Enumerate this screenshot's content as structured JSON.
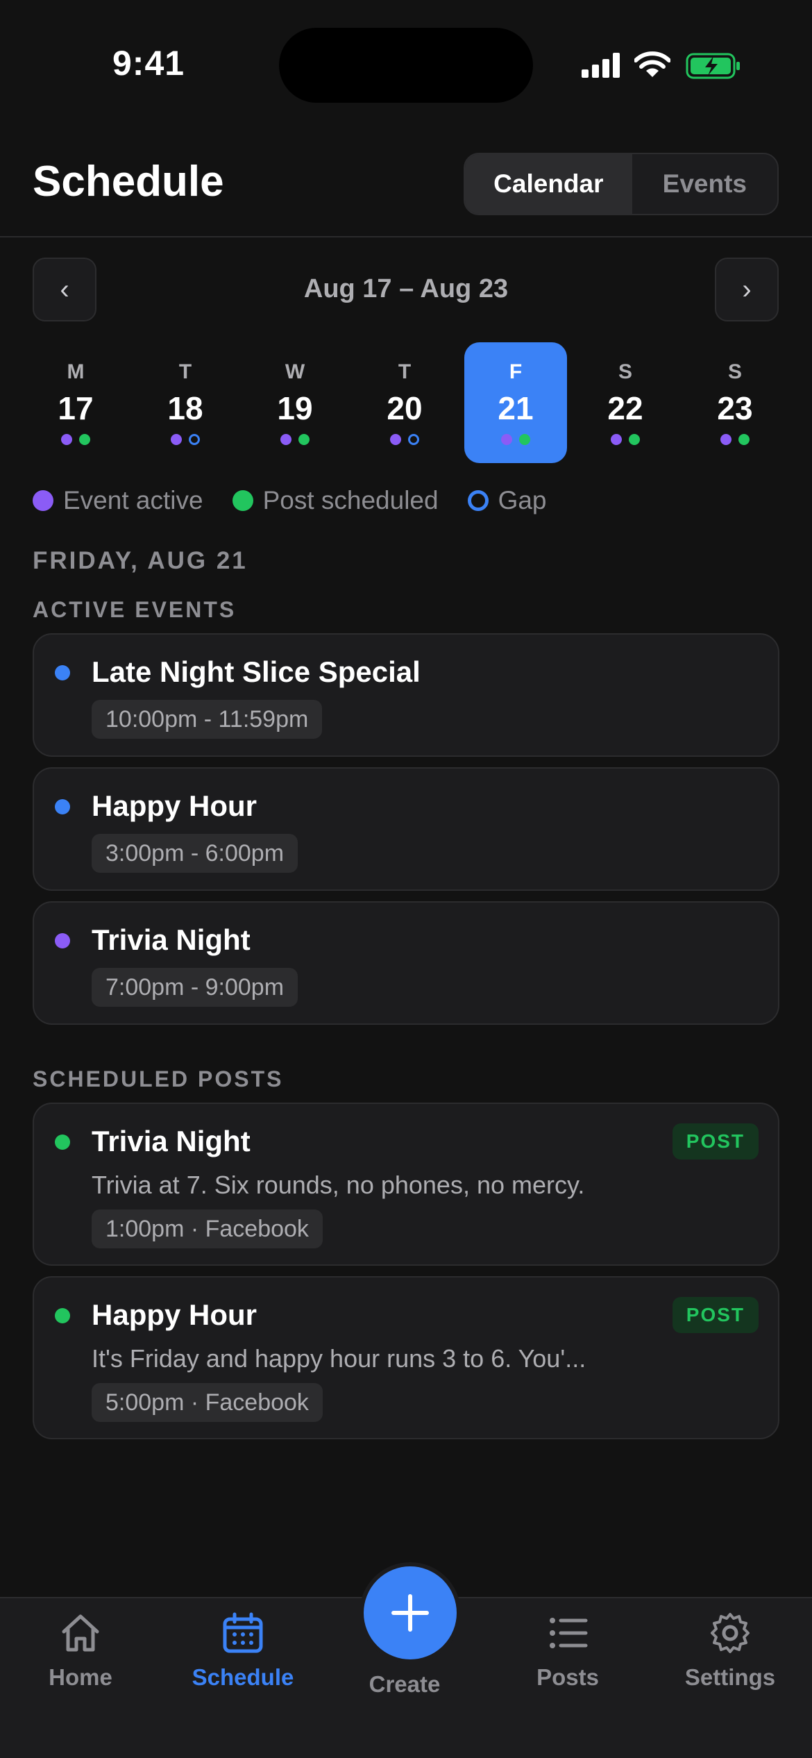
{
  "status_bar": {
    "time": "9:41"
  },
  "header": {
    "title": "Schedule",
    "segments": [
      {
        "label": "Calendar",
        "active": true
      },
      {
        "label": "Events",
        "active": false
      }
    ]
  },
  "week": {
    "range": "Aug 17 – Aug 23",
    "prev_label": "‹",
    "next_label": "›",
    "days": [
      {
        "letter": "M",
        "num": "17",
        "dots": [
          "event",
          "post"
        ],
        "selected": false
      },
      {
        "letter": "T",
        "num": "18",
        "dots": [
          "event",
          "gap"
        ],
        "selected": false
      },
      {
        "letter": "W",
        "num": "19",
        "dots": [
          "event",
          "post"
        ],
        "selected": false
      },
      {
        "letter": "T",
        "num": "20",
        "dots": [
          "event",
          "gap"
        ],
        "selected": false
      },
      {
        "letter": "F",
        "num": "21",
        "dots": [
          "event",
          "post"
        ],
        "selected": true
      },
      {
        "letter": "S",
        "num": "22",
        "dots": [
          "event",
          "post"
        ],
        "selected": false
      },
      {
        "letter": "S",
        "num": "23",
        "dots": [
          "event",
          "post"
        ],
        "selected": false
      }
    ]
  },
  "legend": {
    "event": "Event active",
    "post": "Post scheduled",
    "gap": "Gap"
  },
  "day_heading": "FRIDAY, AUG 21",
  "active_events": {
    "heading": "ACTIVE EVENTS",
    "items": [
      {
        "title": "Late Night Slice Special",
        "time": "10:00pm - 11:59pm",
        "color": "#3b82f6"
      },
      {
        "title": "Happy Hour",
        "time": "3:00pm - 6:00pm",
        "color": "#3b82f6"
      },
      {
        "title": "Trivia Night",
        "time": "7:00pm - 9:00pm",
        "color": "#8b5cf6"
      }
    ]
  },
  "scheduled_posts": {
    "heading": "SCHEDULED POSTS",
    "items": [
      {
        "title": "Trivia Night",
        "badge": "POST",
        "text": "Trivia at 7. Six rounds, no phones, no mercy.",
        "meta": "1:00pm · Facebook"
      },
      {
        "title": "Happy Hour",
        "badge": "POST",
        "text": "It's Friday and happy hour runs 3 to 6. You'...",
        "meta": "5:00pm · Facebook"
      }
    ]
  },
  "tabbar": {
    "home": "Home",
    "schedule": "Schedule",
    "create": "Create",
    "posts": "Posts",
    "settings": "Settings",
    "active": "schedule"
  },
  "colors": {
    "accent": "#3b82f6",
    "event": "#8b5cf6",
    "post": "#22c55e",
    "background": "#121212"
  }
}
